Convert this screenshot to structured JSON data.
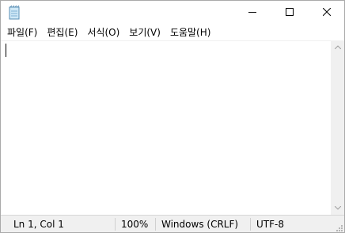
{
  "window": {
    "title": ""
  },
  "titlebar": {
    "app_icon": "notepad-icon",
    "minimize_icon": "minimize-icon",
    "maximize_icon": "maximize-icon",
    "close_icon": "close-icon"
  },
  "menu": {
    "items": [
      {
        "label": "파일(F)"
      },
      {
        "label": "편집(E)"
      },
      {
        "label": "서식(O)"
      },
      {
        "label": "보기(V)"
      },
      {
        "label": "도움말(H)"
      }
    ]
  },
  "editor": {
    "content": ""
  },
  "statusbar": {
    "position": "Ln 1, Col 1",
    "zoom": "100%",
    "line_ending": "Windows (CRLF)",
    "encoding": "UTF-8"
  }
}
